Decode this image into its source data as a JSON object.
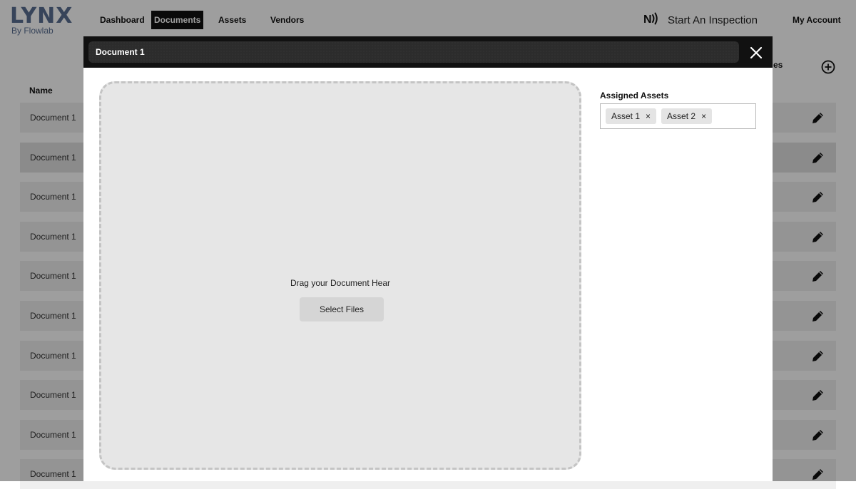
{
  "app": {
    "logo_text": "LYNX",
    "logo_subtext": "By Flowlab",
    "brand_color": "#5a6f92"
  },
  "nav": {
    "items": [
      {
        "label": "Dashboard",
        "active": false
      },
      {
        "label": "Documents",
        "active": true
      },
      {
        "label": "Assets",
        "active": false
      },
      {
        "label": "Vendors",
        "active": false
      }
    ],
    "inspection_label": "Start An Inspection",
    "inspection_icon": "nfc-icon",
    "account_label": "My Account"
  },
  "list": {
    "name_header": "Name",
    "right_header_fragment": "es",
    "add_icon": "plus-circle-icon",
    "rows": [
      {
        "name": "Document 1"
      },
      {
        "name": "Document 1"
      },
      {
        "name": "Document 1"
      },
      {
        "name": "Document 1"
      },
      {
        "name": "Document 1"
      },
      {
        "name": "Document 1"
      },
      {
        "name": "Document 1"
      },
      {
        "name": "Document 1"
      },
      {
        "name": "Document 1"
      },
      {
        "name": "Document 1"
      }
    ],
    "edit_icon": "pencil-icon"
  },
  "modal": {
    "title": "Document 1",
    "close_icon": "close-icon",
    "dropzone_text": "Drag your Document Hear",
    "select_files_label": "Select Files",
    "assigned_assets_label": "Assigned Assets",
    "assigned_assets": [
      {
        "label": "Asset 1",
        "remove": "×"
      },
      {
        "label": "Asset 2",
        "remove": "×"
      }
    ]
  }
}
